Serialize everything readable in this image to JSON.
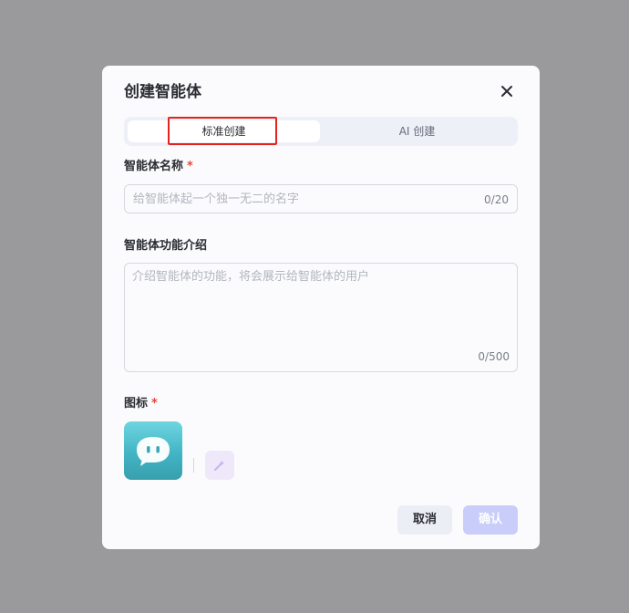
{
  "dialog": {
    "title": "创建智能体",
    "close_icon": "close-icon"
  },
  "tabs": [
    {
      "label": "标准创建",
      "active": true
    },
    {
      "label": "AI 创建",
      "active": false
    }
  ],
  "name_field": {
    "label": "智能体名称",
    "required_mark": "*",
    "placeholder": "给智能体起一个独一无二的名字",
    "counter": "0/20"
  },
  "description_field": {
    "label": "智能体功能介绍",
    "placeholder": "介绍智能体的功能，将会展示给智能体的用户",
    "counter": "0/500"
  },
  "icon_field": {
    "label": "图标",
    "required_mark": "*",
    "avatar_icon": "chat-bubble-face-icon",
    "generate_icon": "magic-sparkle-icon"
  },
  "footer": {
    "cancel_label": "取消",
    "confirm_label": "确认"
  },
  "colors": {
    "overlay": "#9a9a9c",
    "dialog_bg": "#fbfbfd",
    "highlight": "#e3231d",
    "required": "#e5483b",
    "confirm_bg": "#c9cdfa",
    "avatar_teal": "#42b4c4"
  }
}
